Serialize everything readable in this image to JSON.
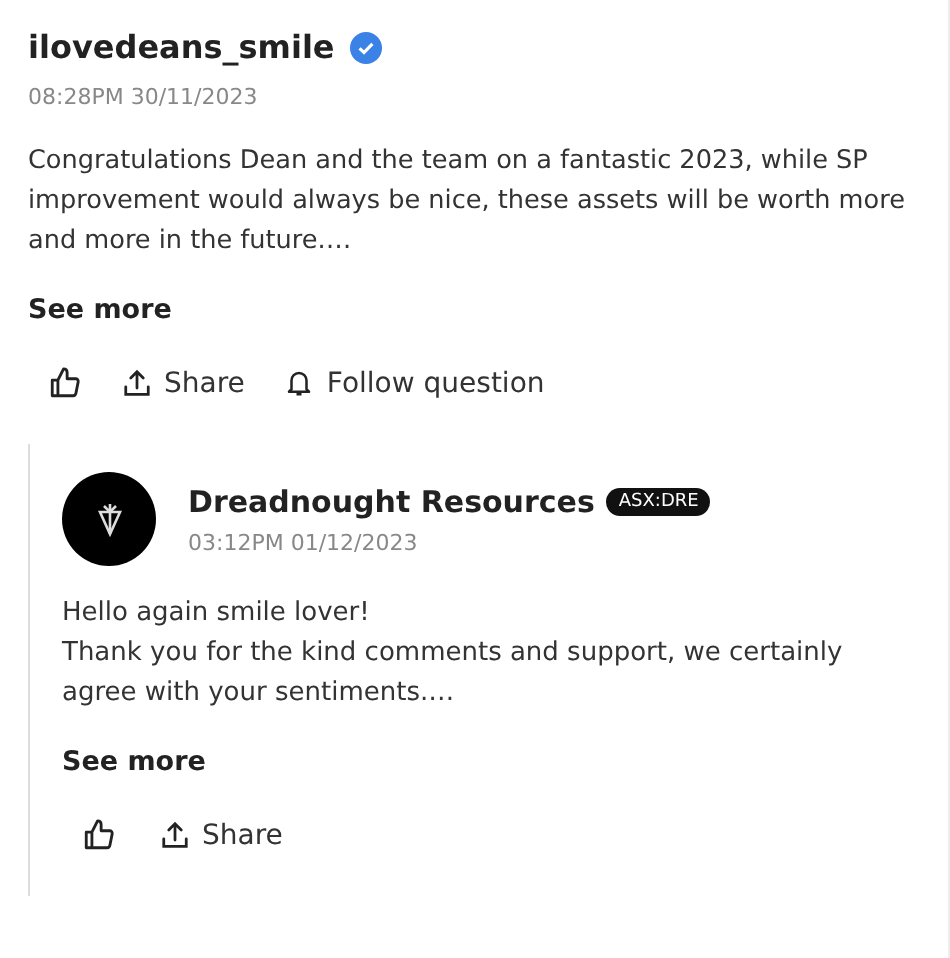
{
  "post": {
    "author": "ilovedeans_smile",
    "verified": true,
    "timestamp": "08:28PM 30/11/2023",
    "body": "Congratulations Dean and the team on a fantastic 2023, while SP improvement would always be nice, these assets will be worth more and more in the future.…",
    "see_more": "See more",
    "actions": [
      {
        "kind": "like"
      },
      {
        "kind": "share",
        "label": "Share"
      },
      {
        "kind": "follow",
        "label": "Follow question"
      }
    ]
  },
  "reply": {
    "author": "Dreadnought Resources",
    "ticker": "ASX:DRE",
    "timestamp": "03:12PM 01/12/2023",
    "body": "Hello again smile lover!\nThank you for the kind comments and support, we certainly agree with your sentiments.…",
    "see_more": "See more",
    "actions": [
      {
        "kind": "like"
      },
      {
        "kind": "share",
        "label": "Share"
      }
    ]
  }
}
